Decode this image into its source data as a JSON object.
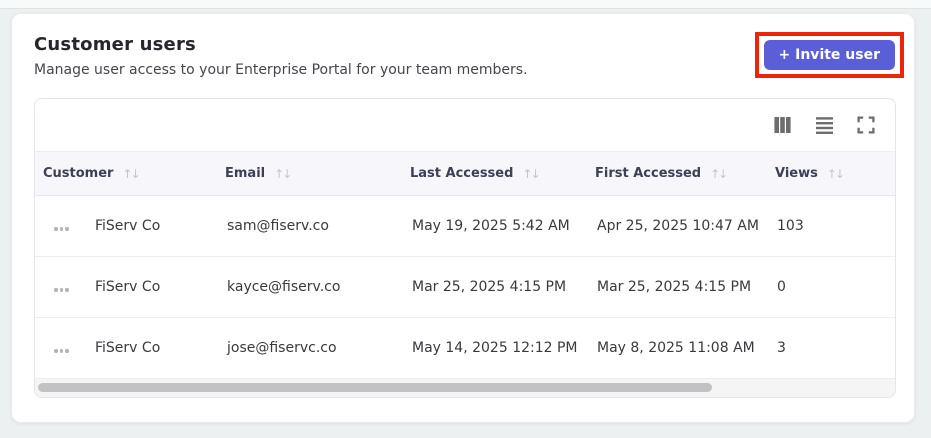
{
  "header": {
    "title": "Customer users",
    "subtitle": "Manage user access to your Enterprise Portal for your team members.",
    "invite_button": "+ Invite user"
  },
  "toolbar": {
    "icons": [
      "columns-view",
      "density-list",
      "fullscreen"
    ]
  },
  "icons": {
    "sort": "↑↓"
  },
  "table": {
    "columns": [
      {
        "label": "Customer",
        "sortable": true
      },
      {
        "label": "Email",
        "sortable": true
      },
      {
        "label": "Last Accessed",
        "sortable": true
      },
      {
        "label": "First Accessed",
        "sortable": true
      },
      {
        "label": "Views",
        "sortable": true
      }
    ],
    "rows": [
      {
        "customer": "FiServ Co",
        "email": "sam@fiserv.co",
        "last_accessed": "May 19, 2025 5:42 AM",
        "first_accessed": "Apr 25, 2025 10:47 AM",
        "views": "103"
      },
      {
        "customer": "FiServ Co",
        "email": "kayce@fiserv.co",
        "last_accessed": "Mar 25, 2025 4:15 PM",
        "first_accessed": "Mar 25, 2025 4:15 PM",
        "views": "0"
      },
      {
        "customer": "FiServ Co",
        "email": "jose@fiservc.co",
        "last_accessed": "May 14, 2025 12:12 PM",
        "first_accessed": "May 8, 2025 11:08 AM",
        "views": "3"
      }
    ]
  },
  "colors": {
    "accent": "#5a5fd8",
    "highlight_red": "#ee2409",
    "header_bg": "#f7f7fb",
    "page_bg": "#edf0f1"
  }
}
